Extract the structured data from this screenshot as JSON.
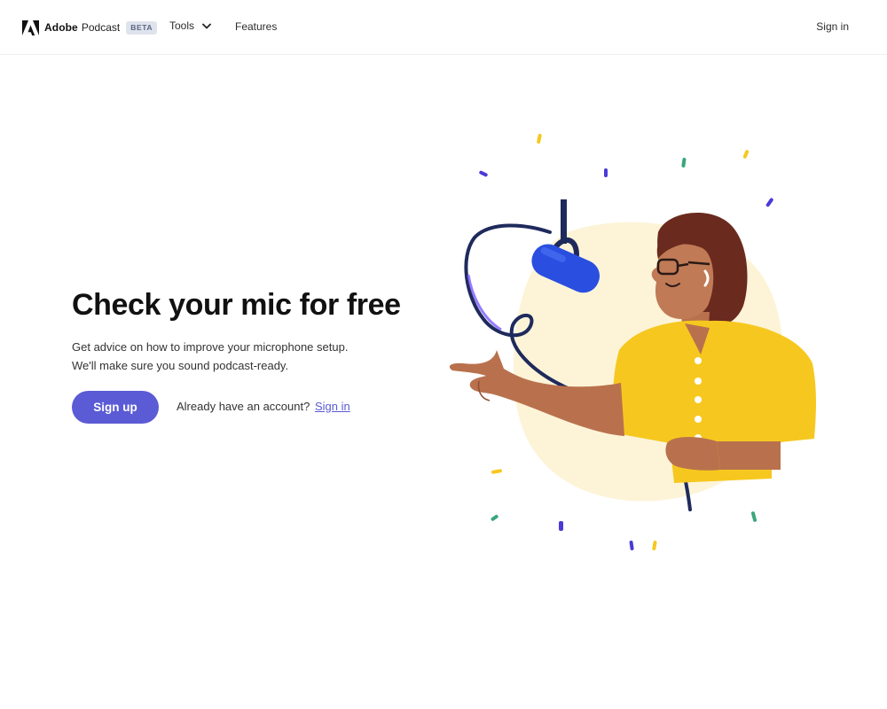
{
  "header": {
    "brand_adobe": "Adobe",
    "brand_podcast": "Podcast",
    "beta_badge": "BETA",
    "nav_tools": "Tools",
    "nav_features": "Features",
    "sign_in": "Sign in"
  },
  "hero": {
    "headline": "Check your mic for free",
    "subtext_line1": "Get advice on how to improve your microphone setup.",
    "subtext_line2": "We'll make sure you sound podcast-ready.",
    "signup_button": "Sign up",
    "account_prompt": "Already have an account?",
    "signin_link": "Sign in"
  },
  "icons": {
    "brand_logo": "adobe-logo-icon",
    "tools_dropdown": "chevron-down-icon"
  },
  "colors": {
    "accent": "#5b5bd6",
    "beta_badge_bg": "#dfe3ee",
    "shirt_yellow": "#f6c81f",
    "mic_blue": "#2a4fe0",
    "cable_navy": "#1f2a5c",
    "hair": "#6b2a1e",
    "skin": "#b9714d"
  }
}
